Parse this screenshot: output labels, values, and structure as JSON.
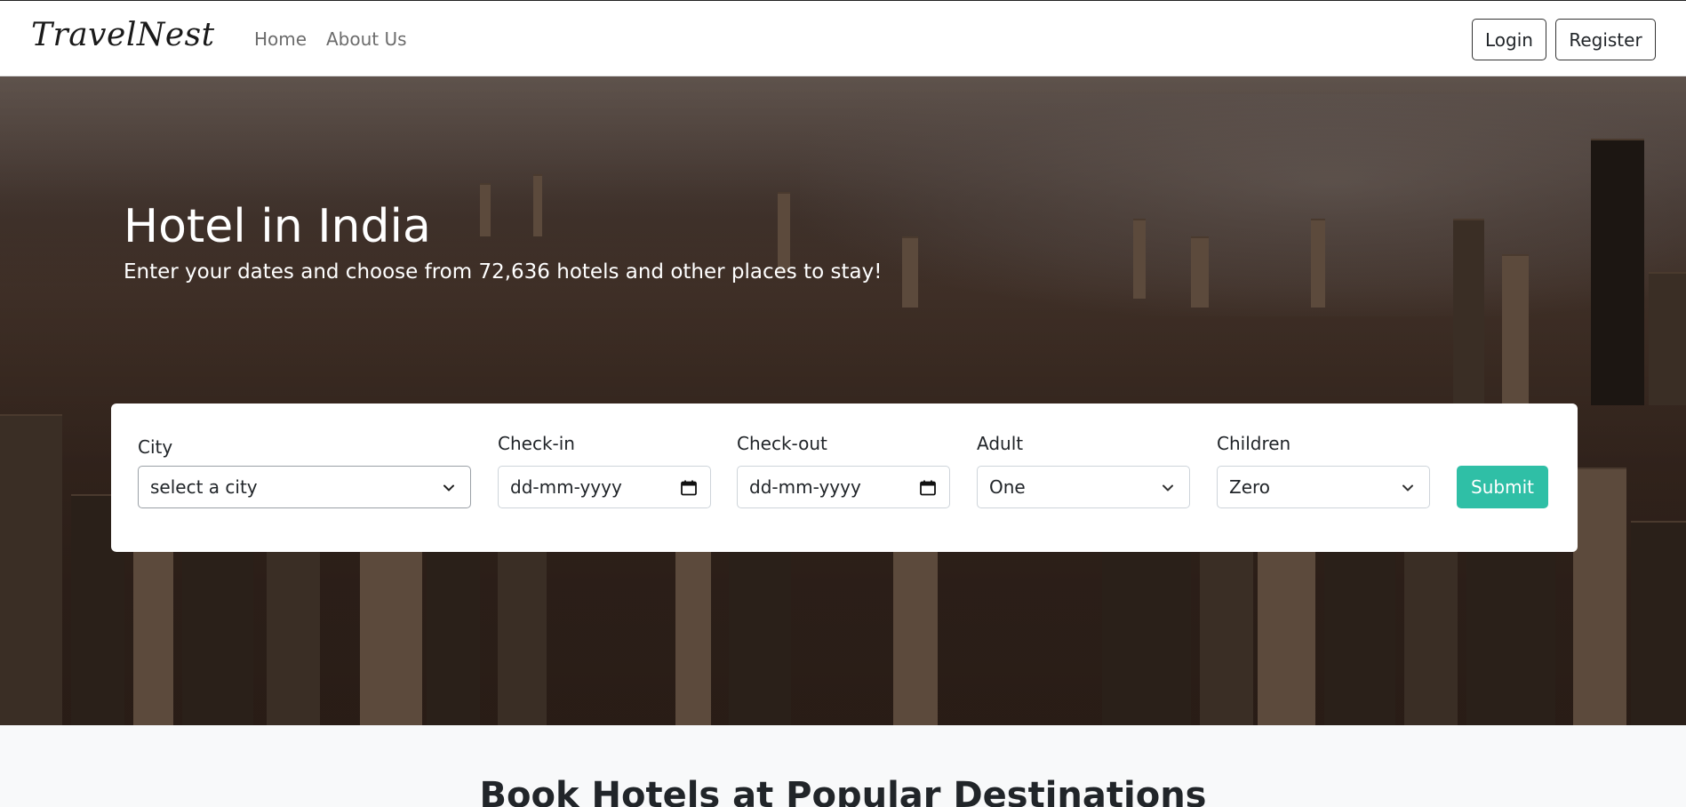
{
  "navbar": {
    "brand": "TravelNest",
    "links": [
      {
        "label": "Home"
      },
      {
        "label": "About Us"
      }
    ],
    "login_label": "Login",
    "register_label": "Register"
  },
  "hero": {
    "title": "Hotel in India",
    "subtitle": "Enter your dates and choose from 72,636 hotels and other places to stay!"
  },
  "search": {
    "city": {
      "label": "City",
      "value": "select a city"
    },
    "checkin": {
      "label": "Check-in",
      "value": "dd-mm-yyyy",
      "icon": "calendar-icon"
    },
    "checkout": {
      "label": "Check-out",
      "value": "dd-mm-yyyy",
      "icon": "calendar-icon"
    },
    "adult": {
      "label": "Adult",
      "value": "One",
      "icon": "chevron-down-icon"
    },
    "children": {
      "label": "Children",
      "value": "Zero",
      "icon": "chevron-down-icon"
    },
    "submit_label": "Submit"
  },
  "popular": {
    "title": "Book Hotels at Popular Destinations"
  },
  "colors": {
    "accent": "#2fbfa6",
    "navbar_bg": "#ffffff",
    "page_bg": "#f8f9fa"
  }
}
